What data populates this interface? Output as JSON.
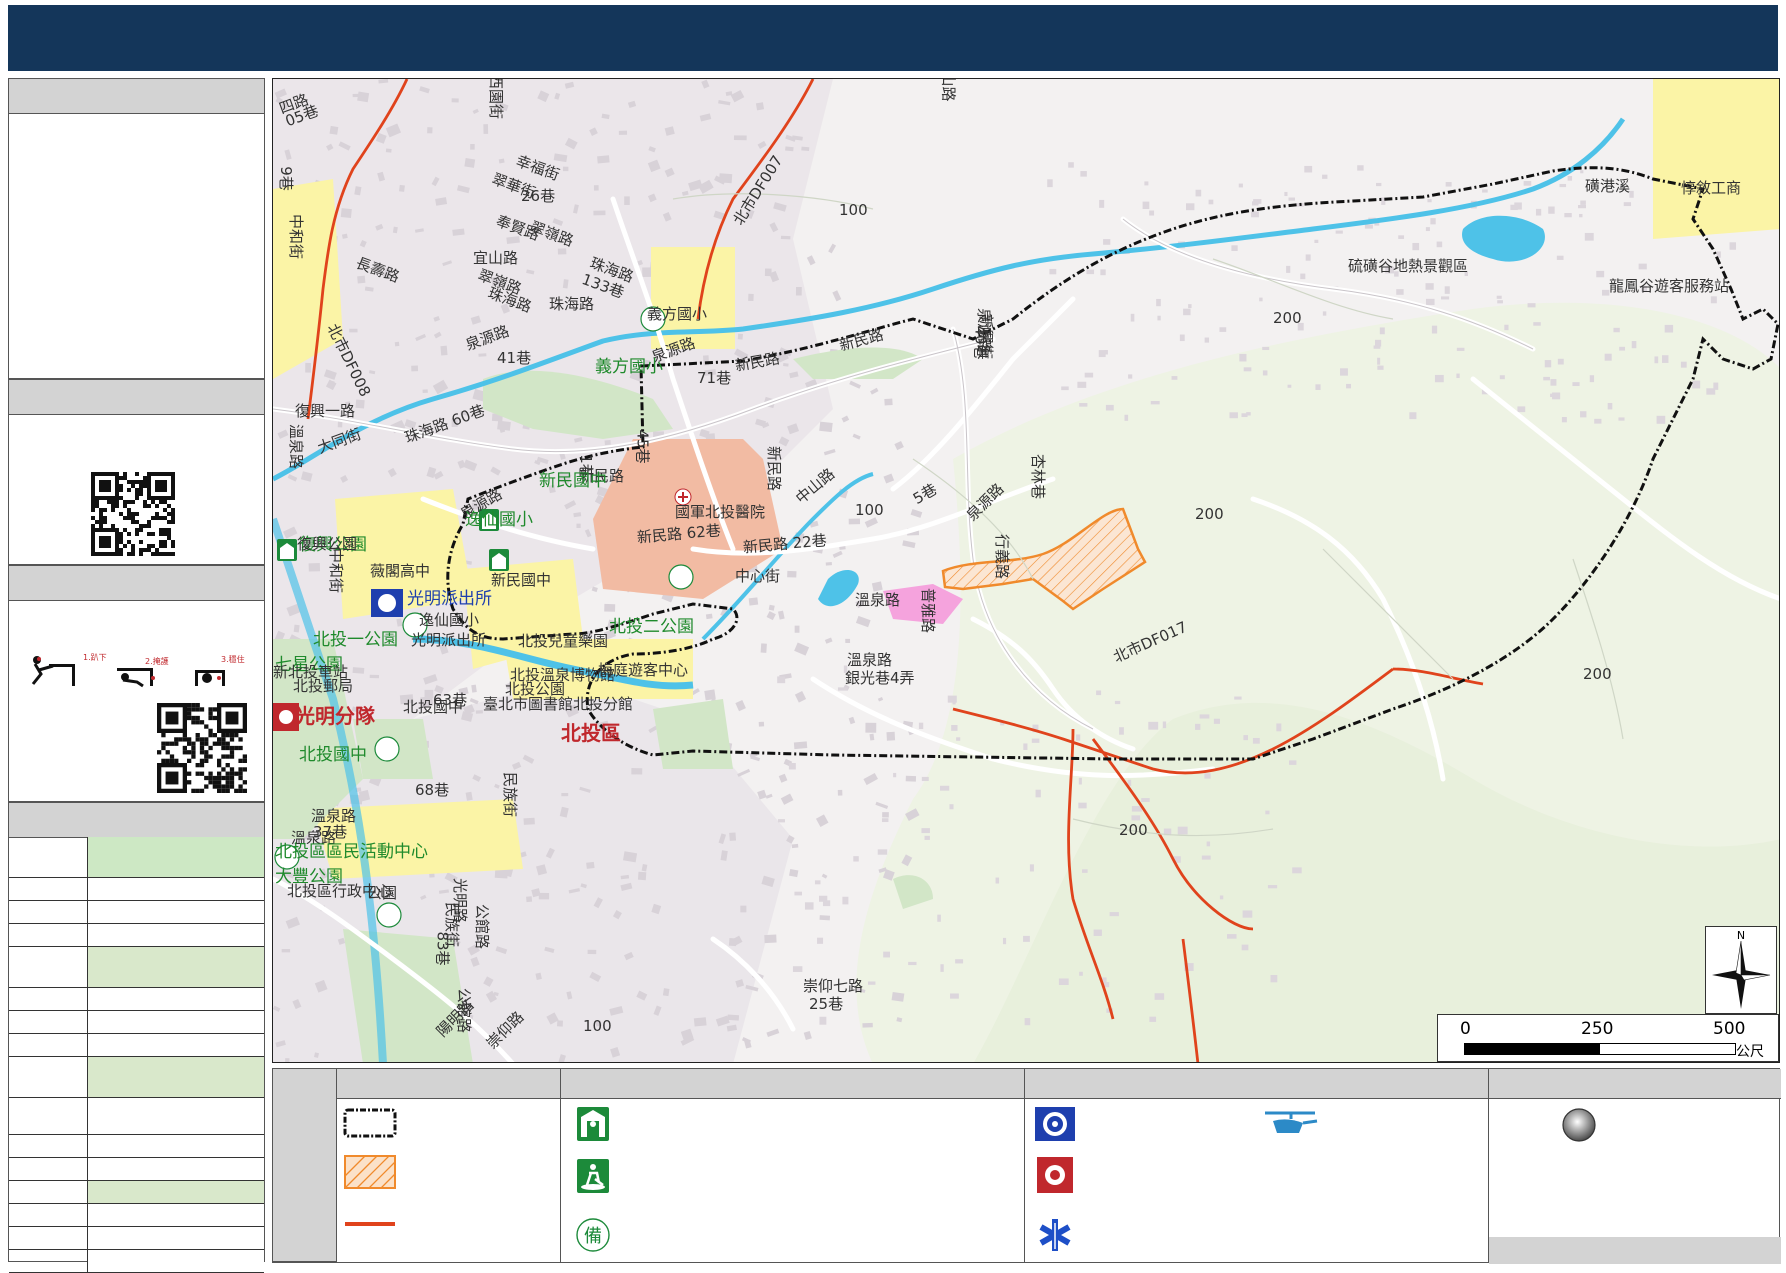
{
  "map": {
    "district": "北投區",
    "roads": [
      {
        "t": "西園街"
      },
      {
        "t": "翠華街"
      },
      {
        "t": "幸福街"
      },
      {
        "t": "26巷"
      },
      {
        "t": "翠嶺路"
      },
      {
        "t": "奉賢路"
      },
      {
        "t": "宜山路"
      },
      {
        "t": "翠嶺路"
      },
      {
        "t": "長壽路"
      },
      {
        "t": "珠海路"
      },
      {
        "t": "珠海路"
      },
      {
        "t": "泉源路"
      },
      {
        "t": "41巷"
      },
      {
        "t": "珠海路"
      },
      {
        "t": "133巷"
      },
      {
        "t": "泉源路"
      },
      {
        "t": "71巷"
      },
      {
        "t": "新民路"
      },
      {
        "t": "新民路"
      },
      {
        "t": "新民路"
      },
      {
        "t": "新民路 62巷"
      },
      {
        "t": "新民路 22巷"
      },
      {
        "t": "中心街"
      },
      {
        "t": "中山路"
      },
      {
        "t": "溫泉路"
      },
      {
        "t": "普雅路"
      },
      {
        "t": "5巷"
      },
      {
        "t": "溫泉路"
      },
      {
        "t": "銀光巷4弄"
      },
      {
        "t": "杏林巷"
      },
      {
        "t": "泉源路"
      },
      {
        "t": "珠海路 60巷"
      },
      {
        "t": "中和街"
      },
      {
        "t": "泉源路"
      },
      {
        "t": "溫泉路"
      },
      {
        "t": "37巷"
      },
      {
        "t": "68巷"
      },
      {
        "t": "民族街"
      },
      {
        "t": "溫泉路"
      },
      {
        "t": "光明路"
      },
      {
        "t": "崇仰七路"
      },
      {
        "t": "25巷"
      },
      {
        "t": "陽明路"
      },
      {
        "t": "行義路"
      },
      {
        "t": "40巷"
      },
      {
        "t": "1巷"
      },
      {
        "t": "新民路"
      },
      {
        "t": "45巷"
      },
      {
        "t": "復興一路"
      },
      {
        "t": "大同街"
      },
      {
        "t": "中和街"
      },
      {
        "t": "溫泉路"
      },
      {
        "t": "63巷"
      },
      {
        "t": "民族街"
      },
      {
        "t": "公館路"
      },
      {
        "t": "83巷"
      },
      {
        "t": "公館路"
      },
      {
        "t": "崇仰路"
      },
      {
        "t": "泉源路"
      },
      {
        "t": "新興街"
      },
      {
        "t": "山路"
      },
      {
        "t": "四路"
      },
      {
        "t": "05巷"
      },
      {
        "t": "9巷"
      }
    ],
    "places": [
      {
        "t": "義方國小"
      },
      {
        "t": "新民國中"
      },
      {
        "t": "逸仙國小"
      },
      {
        "t": "復興公園"
      },
      {
        "t": "北投一公園"
      },
      {
        "t": "七星公園"
      },
      {
        "t": "北投二公園"
      },
      {
        "t": "北投國中"
      },
      {
        "t": "北投區區民活動中心"
      },
      {
        "t": "大豐公園"
      },
      {
        "t": "國軍北投醫院"
      },
      {
        "t": "光明派出所"
      },
      {
        "t": "光明分隊"
      },
      {
        "t": "北投兒童樂園"
      },
      {
        "t": "北投溫泉博物館"
      },
      {
        "t": "臺北市圖書館北投分館"
      },
      {
        "t": "北投公園"
      },
      {
        "t": "梅庭遊客中心"
      },
      {
        "t": "北投郵局"
      },
      {
        "t": "北投國中"
      },
      {
        "t": "復興公園"
      },
      {
        "t": "薇閣高中"
      },
      {
        "t": "新民國中"
      },
      {
        "t": "逸仙國小"
      },
      {
        "t": "光明派出所"
      },
      {
        "t": "新北投車站"
      },
      {
        "t": "硫磺谷地熱景觀區"
      },
      {
        "t": "龍鳳谷遊客服務站"
      },
      {
        "t": "惇敘工商"
      },
      {
        "t": "磺港溪"
      },
      {
        "t": "北投區行政中心"
      },
      {
        "t": "公園"
      },
      {
        "t": "義方國小"
      }
    ],
    "streams": [
      "北市DF007",
      "北市DF008",
      "北市DF017"
    ],
    "contours": [
      "100",
      "100",
      "200",
      "200",
      "200",
      "200",
      "100"
    ],
    "north": "N",
    "scale": {
      "ticks": [
        "0",
        "250",
        "500"
      ],
      "unit": "公尺"
    }
  },
  "colors": {
    "title_bar": "#14365a",
    "panel_header": "#d3d3d3",
    "table_fill": "#d3e9c5",
    "stream": "#e0431c",
    "risk_area": "#f08a2c",
    "river": "#4ec2e8",
    "green": "#d2e6c7",
    "school": "#fbf4a6",
    "hospital": "#f2bba3",
    "boundary": "#111111"
  },
  "left_panel": {
    "qr_icons": [
      "qr-code-icon",
      "qr-code-icon"
    ],
    "drill": {
      "steps": [
        "1.趴下",
        "2.掩護",
        "3.穩住"
      ]
    },
    "table_row_fills": [
      "#cde8c4",
      "#fff",
      "#fff",
      "#fff",
      "#d9e8cb",
      "#fff",
      "#fff",
      "#fff",
      "#d9e8cb",
      "#fff",
      "#fff",
      "#fff",
      "#d9e8cb",
      "#fff",
      "#fff",
      "#fff"
    ]
  },
  "legend": {
    "icons": [
      "boundary-icon",
      "risk-area-icon",
      "stream-icon",
      "shelter-icon",
      "park-evacuation-icon",
      "reserve-icon",
      "police-icon",
      "helicopter-icon",
      "fire-icon",
      "ambulance-icon",
      "gray-circle-icon"
    ]
  }
}
